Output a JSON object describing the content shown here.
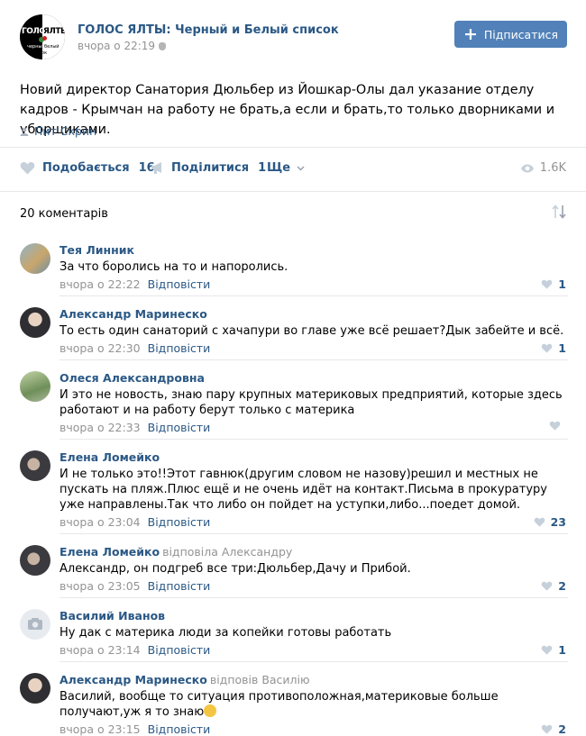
{
  "post": {
    "author": "ГОЛОС ЯЛТЫ: Черный и Белый список",
    "date": "вчора о 22:19",
    "subscribe_label": "Підписатися",
    "text": "Новий директор Санатория Дюльбер из Йошкар-Олы дал указание отделу кадров - Крымчан на работу не брать,а если и брать,то только дворниками и уборщиками.",
    "signer": "Пит Скрин",
    "logo": {
      "left": "ГОЛОС",
      "right": "ЯЛТЫ",
      "sub_left": "черный",
      "sub_right": "белый",
      "bottom": "список"
    }
  },
  "actions": {
    "like_label": "Подобається",
    "like_count": "16",
    "share_label": "Поділитися",
    "share_count": "1",
    "more_label": "Ще",
    "views": "1.6K"
  },
  "comments_header": "20 коментарів",
  "reply_label": "Відповісти",
  "comments": [
    {
      "name": "Тея Линник",
      "reply_to": "",
      "text": "За что боролись на то и напоролись.",
      "time": "вчора о 22:22",
      "likes": "1"
    },
    {
      "name": "Александр Маринеско",
      "reply_to": "",
      "text": "То есть один санаторий с хачапури во главе уже всё решает?Дык забейте и всё.",
      "time": "вчора о 22:30",
      "likes": "1"
    },
    {
      "name": "Олеся Александровна",
      "reply_to": "",
      "text": "И это не новость, знаю пару крупных материковых предприятий, которые здесь работают и на работу берут только с материка",
      "time": "вчора о 22:33",
      "likes": ""
    },
    {
      "name": "Елена Ломейко",
      "reply_to": "",
      "text": "И не только это!!Этот гавнюк(другим словом не назову)решил и местных не пускать на пляж.Плюс ещё и не очень идёт на контакт.Письма в прокуратуру уже направлены.Так что либо он пойдет на уступки,либо...поедет домой.",
      "time": "вчора о 23:04",
      "likes": "23"
    },
    {
      "name": "Елена Ломейко",
      "reply_to": "відповіла Александру",
      "text": "Александр, он подгреб все три:Дюльбер,Дачу и Прибой.",
      "time": "вчора о 23:05",
      "likes": "2"
    },
    {
      "name": "Василий Иванов",
      "reply_to": "",
      "text": "Ну дак с материка люди за копейки готовы работать",
      "time": "вчора о 23:14",
      "likes": "1"
    },
    {
      "name": "Александр Маринеско",
      "reply_to": "відповів Василію",
      "text": "Василий, вообще то ситуация противоположная,материковые больше получают,уж я то знаю",
      "time": "вчора о 23:15",
      "likes": "2"
    }
  ],
  "colors": {
    "link": "#2a5885",
    "button": "#5181b8",
    "muted": "#939393",
    "separator": "#e7e8ec"
  }
}
